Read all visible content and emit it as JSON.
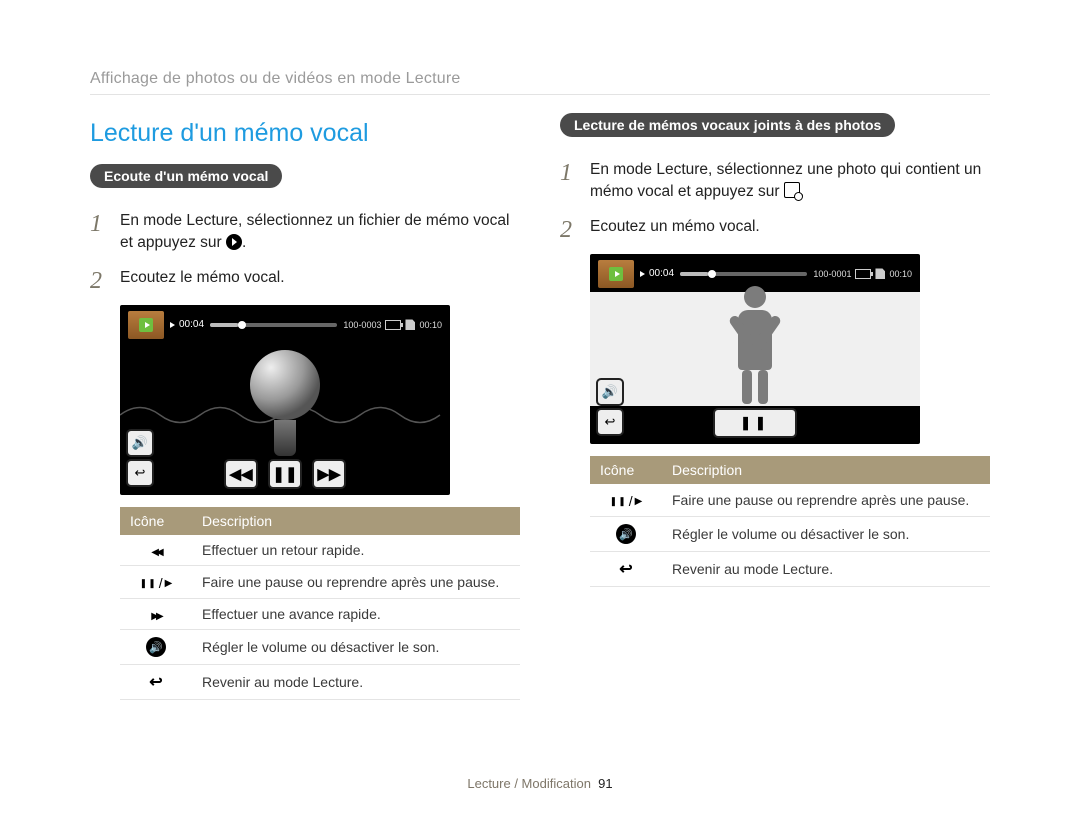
{
  "breadcrumb": "Affichage de photos ou de vidéos en mode Lecture",
  "title": "Lecture d'un mémo vocal",
  "left": {
    "pill": "Ecoute d'un mémo vocal",
    "step1": "En mode Lecture, sélectionnez un fichier de mémo vocal et appuyez sur ",
    "step2": "Ecoutez le mémo vocal.",
    "screenshot": {
      "elapsed": "00:04",
      "file": "100-0003",
      "total": "00:10"
    },
    "table": {
      "headers": {
        "icon": "Icône",
        "desc": "Description"
      },
      "rows": [
        {
          "icon": "rewind",
          "desc": "Effectuer un retour rapide."
        },
        {
          "icon": "pause-play",
          "desc": "Faire une pause ou reprendre après une pause."
        },
        {
          "icon": "forward",
          "desc": "Effectuer une avance rapide."
        },
        {
          "icon": "volume",
          "desc": "Régler le volume ou désactiver le son."
        },
        {
          "icon": "back",
          "desc": "Revenir au mode Lecture."
        }
      ]
    }
  },
  "right": {
    "pill": "Lecture de mémos vocaux joints à des photos",
    "step1a": "En mode Lecture, sélectionnez une photo qui contient un mémo vocal et appuyez sur ",
    "step2": "Ecoutez un mémo vocal.",
    "screenshot": {
      "elapsed": "00:04",
      "file": "100-0001",
      "total": "00:10"
    },
    "table": {
      "headers": {
        "icon": "Icône",
        "desc": "Description"
      },
      "rows": [
        {
          "icon": "pause-play",
          "desc": "Faire une pause ou reprendre après une pause."
        },
        {
          "icon": "volume",
          "desc": "Régler le volume ou désactiver le son."
        },
        {
          "icon": "back",
          "desc": "Revenir au mode Lecture."
        }
      ]
    }
  },
  "footer": {
    "section": "Lecture / Modification",
    "page": "91"
  }
}
